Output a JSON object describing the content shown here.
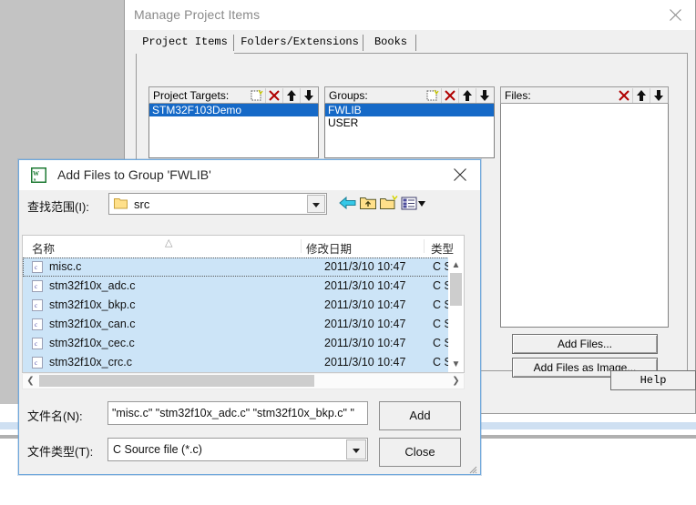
{
  "desktop": {
    "background": "#c3c3c3"
  },
  "manage_window": {
    "title": "Manage Project Items",
    "close_icon": "close-icon",
    "tabs": [
      {
        "label": "Project Items",
        "selected": true
      },
      {
        "label": "Folders/Extensions",
        "selected": false
      },
      {
        "label": "Books",
        "selected": false
      }
    ],
    "targets_panel": {
      "label": "Project Targets:",
      "tools": [
        "new-icon",
        "delete-icon",
        "move-up-icon",
        "move-down-icon"
      ],
      "items": [
        {
          "label": "STM32F103Demo",
          "selected": true
        }
      ]
    },
    "groups_panel": {
      "label": "Groups:",
      "tools": [
        "new-icon",
        "delete-icon",
        "move-up-icon",
        "move-down-icon"
      ],
      "items": [
        {
          "label": "FWLIB",
          "selected": true
        },
        {
          "label": "USER",
          "selected": false
        }
      ]
    },
    "files_panel": {
      "label": "Files:",
      "tools": [
        "delete-icon",
        "move-up-icon",
        "move-down-icon"
      ],
      "items": []
    },
    "buttons": {
      "add_files": "Add Files...",
      "add_files_as_image": "Add Files as Image...",
      "help": "Help"
    }
  },
  "add_files_dialog": {
    "title": "Add Files to Group 'FWLIB'",
    "app_icon": "keil-uvision-icon",
    "close_icon": "close-icon",
    "look_in": {
      "label": "查找范围(I):",
      "value": "src",
      "folder_icon": "folder-icon",
      "dropdown_icon": "chevron-down-icon"
    },
    "nav_icons": [
      "back-arrow-icon",
      "up-folder-icon",
      "new-folder-icon",
      "view-mode-icon"
    ],
    "file_list": {
      "columns": [
        "名称",
        "修改日期",
        "类型"
      ],
      "sort_indicator": "sort-ascending-icon",
      "rows": [
        {
          "name": "misc.c",
          "date": "2011/3/10 10:47",
          "type": "C Sc",
          "selected": true,
          "focused": true
        },
        {
          "name": "stm32f10x_adc.c",
          "date": "2011/3/10 10:47",
          "type": "C Sc",
          "selected": true,
          "focused": false
        },
        {
          "name": "stm32f10x_bkp.c",
          "date": "2011/3/10 10:47",
          "type": "C Sc",
          "selected": true,
          "focused": false
        },
        {
          "name": "stm32f10x_can.c",
          "date": "2011/3/10 10:47",
          "type": "C Sc",
          "selected": true,
          "focused": false
        },
        {
          "name": "stm32f10x_cec.c",
          "date": "2011/3/10 10:47",
          "type": "C Sc",
          "selected": true,
          "focused": false
        },
        {
          "name": "stm32f10x_crc.c",
          "date": "2011/3/10 10:47",
          "type": "C Sc",
          "selected": true,
          "focused": false
        }
      ],
      "scrollbar_vertical": {
        "up": "▲",
        "down": "▼"
      },
      "scrollbar_horizontal": {
        "left": "❮",
        "right": "❯"
      }
    },
    "file_name": {
      "label": "文件名(N):",
      "value": "\"misc.c\" \"stm32f10x_adc.c\" \"stm32f10x_bkp.c\" \""
    },
    "file_type": {
      "label": "文件类型(T):",
      "value": "C Source file (*.c)",
      "dropdown_icon": "chevron-down-icon"
    },
    "buttons": {
      "add": "Add",
      "close": "Close"
    }
  }
}
